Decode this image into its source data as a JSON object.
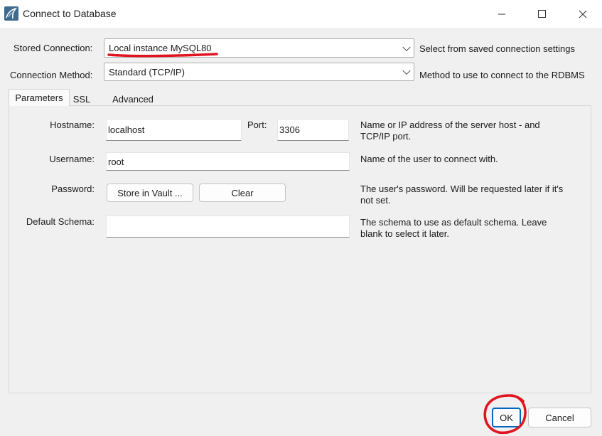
{
  "window": {
    "title": "Connect to Database",
    "minimize_icon": "minimize-icon",
    "maximize_icon": "maximize-icon",
    "close_icon": "close-icon"
  },
  "stored_connection": {
    "label": "Stored Connection:",
    "value": "Local instance MySQL80",
    "description": "Select from saved connection settings"
  },
  "connection_method": {
    "label": "Connection Method:",
    "value": "Standard (TCP/IP)",
    "description": "Method to use to connect to the RDBMS"
  },
  "tabs": [
    {
      "label": "Parameters",
      "active": true
    },
    {
      "label": "SSL",
      "active": false
    },
    {
      "label": "Advanced",
      "active": false
    }
  ],
  "parameters": {
    "hostname": {
      "label": "Hostname:",
      "value": "localhost"
    },
    "port": {
      "label": "Port:",
      "value": "3306"
    },
    "hostname_description": "Name or IP address of the server host - and TCP/IP port.",
    "username": {
      "label": "Username:",
      "value": "root",
      "description": "Name of the user to connect with."
    },
    "password": {
      "label": "Password:",
      "store_button": "Store in Vault ...",
      "clear_button": "Clear",
      "description": "The user's password. Will be requested later if it's not set."
    },
    "default_schema": {
      "label": "Default Schema:",
      "value": "",
      "description": "The schema to use as default schema. Leave blank to select it later."
    }
  },
  "footer": {
    "ok_label": "OK",
    "cancel_label": "Cancel"
  },
  "colors": {
    "annotation": "#e0141e",
    "focus_accent": "#0067c0"
  }
}
